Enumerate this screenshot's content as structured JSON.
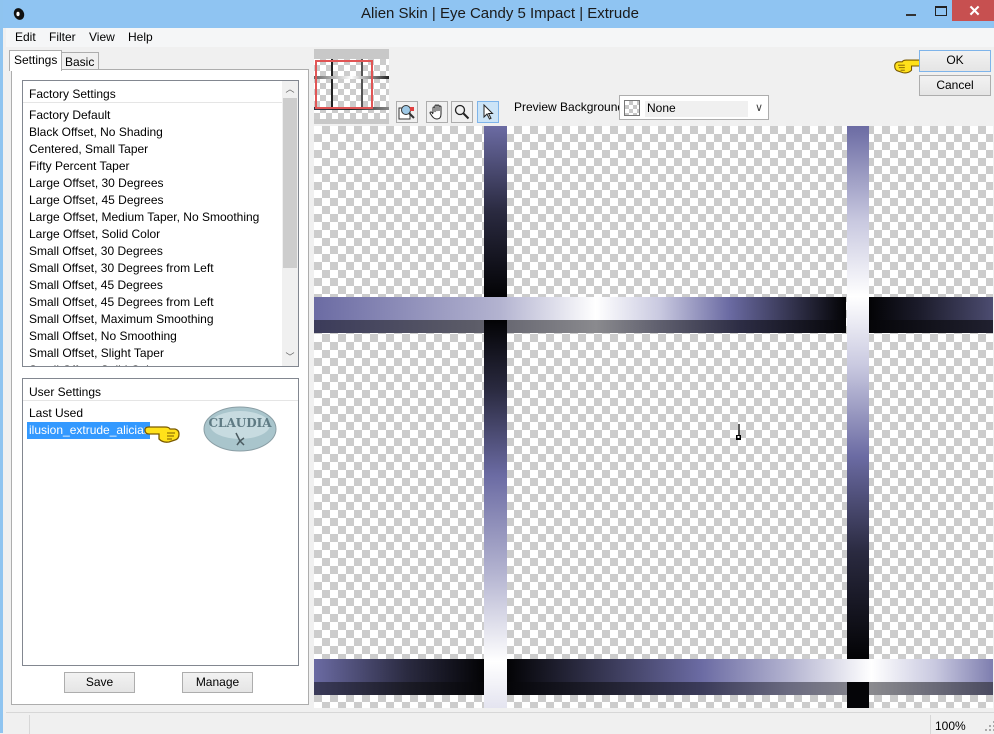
{
  "window": {
    "title": "Alien Skin | Eye Candy 5 Impact | Extrude",
    "controls": {
      "minimize": "–",
      "maximize": "□",
      "close": "✕"
    }
  },
  "menu": [
    "Edit",
    "Filter",
    "View",
    "Help"
  ],
  "tabs": [
    {
      "label": "Settings",
      "active": true
    },
    {
      "label": "Basic",
      "active": false
    }
  ],
  "factory_settings": {
    "header": "Factory Settings",
    "items": [
      "Factory Default",
      "Black Offset, No Shading",
      "Centered, Small Taper",
      "Fifty Percent Taper",
      "Large Offset, 30 Degrees",
      "Large Offset, 45 Degrees",
      "Large Offset, Medium Taper, No Smoothing",
      "Large Offset, Solid Color",
      "Small Offset, 30 Degrees",
      "Small Offset, 30 Degrees from Left",
      "Small Offset, 45 Degrees",
      "Small Offset, 45 Degrees from Left",
      "Small Offset, Maximum Smoothing",
      "Small Offset, No Smoothing",
      "Small Offset, Slight Taper",
      "Small Offset, Solid Color"
    ]
  },
  "user_settings": {
    "header": "User Settings",
    "items": [
      "Last Used",
      "ilusion_extrude_aliciar"
    ],
    "selected": "ilusion_extrude_aliciar",
    "watermark": "CLAUDIA"
  },
  "buttons": {
    "save": "Save",
    "manage": "Manage",
    "ok": "OK",
    "cancel": "Cancel"
  },
  "toolbar": {
    "tools": [
      "navigator-tool",
      "hand-tool",
      "zoom-tool",
      "pointer-tool"
    ],
    "active_tool": "pointer-tool",
    "preview_background_label": "Preview Background:",
    "preview_background_value": "None"
  },
  "status": {
    "zoom": "100%"
  },
  "colors": {
    "titlebar": "#8fc4f2",
    "close_button": "#c75050",
    "selection": "#3399ff",
    "extrude_purple": "#6b6ba3",
    "extrude_dark": "#050508"
  }
}
